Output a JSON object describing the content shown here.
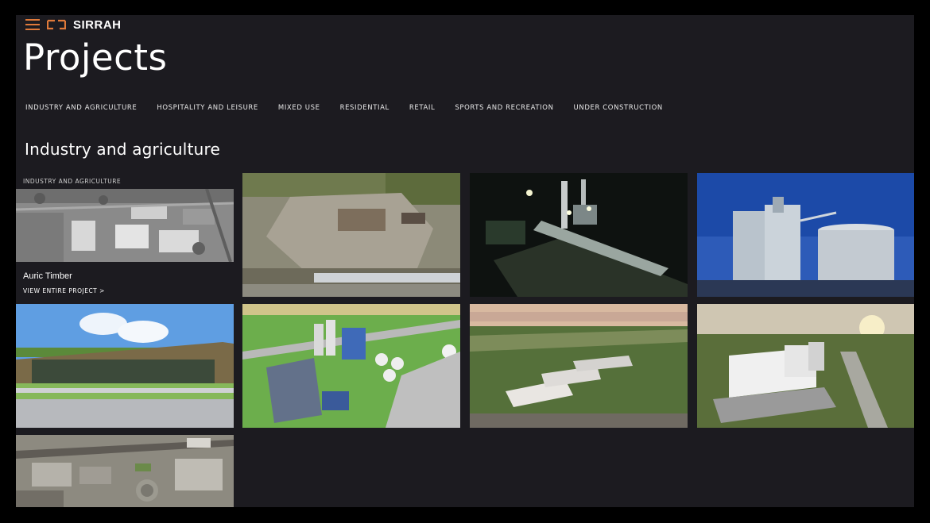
{
  "brand": {
    "name": "SIRRAH",
    "accent": "#e07a3a"
  },
  "page": {
    "title": "Projects"
  },
  "filters": [
    {
      "label": "INDUSTRY AND AGRICULTURE"
    },
    {
      "label": "HOSPITALITY AND LEISURE"
    },
    {
      "label": "MIXED USE"
    },
    {
      "label": "RESIDENTIAL"
    },
    {
      "label": "RETAIL"
    },
    {
      "label": "SPORTS AND RECREATION"
    },
    {
      "label": "UNDER CONSTRUCTION"
    }
  ],
  "section": {
    "title": "Industry and agriculture"
  },
  "featured": {
    "category": "INDUSTRY AND AGRICULTURE",
    "name": "Auric Timber",
    "link": "VIEW ENTIRE PROJECT >"
  },
  "colors": {
    "background": "#1c1b20",
    "text": "#ffffff"
  }
}
